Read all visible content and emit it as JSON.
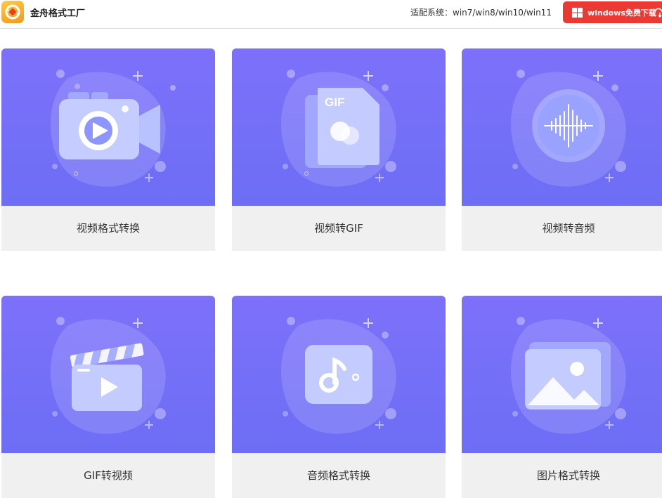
{
  "header": {
    "app_title": "金舟格式工厂",
    "compat_text": "适配系统：win7/win8/win10/win11",
    "download_label": "windows免费下载",
    "logo_icon": "convert-arrows-icon",
    "brand_color": "#f4a82a",
    "download_color": "#ea3a33"
  },
  "cards": [
    {
      "label": "视频格式转换",
      "icon": "video-camera-icon"
    },
    {
      "label": "视频转GIF",
      "icon": "gif-file-icon",
      "icon_text": "GIF"
    },
    {
      "label": "视频转音频",
      "icon": "audio-wave-icon"
    },
    {
      "label": "GIF转视频",
      "icon": "clapperboard-icon"
    },
    {
      "label": "音频格式转换",
      "icon": "music-note-icon"
    },
    {
      "label": "图片格式转换",
      "icon": "image-icon"
    }
  ],
  "colors": {
    "card_bg": "#7470f8",
    "label_bg": "#f0f0f0"
  }
}
